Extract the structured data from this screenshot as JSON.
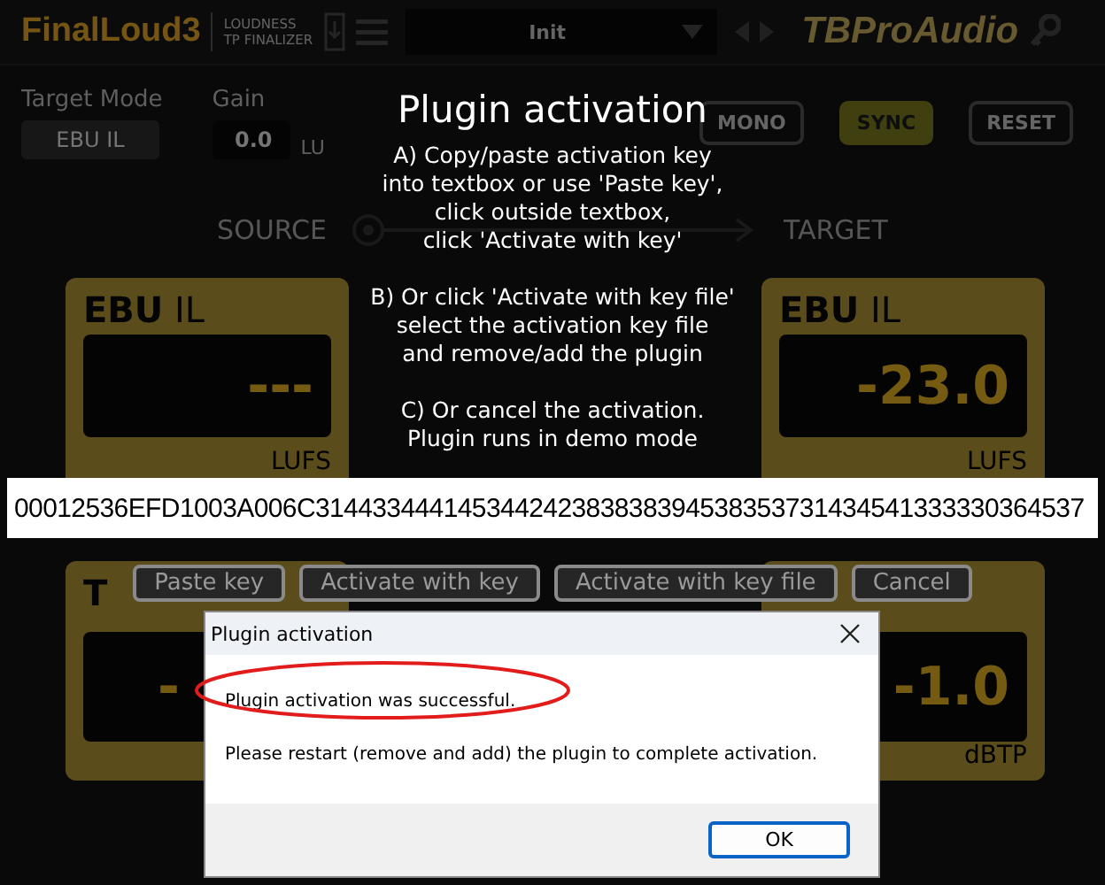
{
  "plugin": {
    "logo": "FinalLoud3",
    "subtitle_lines": [
      "LOUDNESS",
      "TP FINALIZER"
    ],
    "preset": "Init",
    "brand": "TBProAudio",
    "controls": [
      {
        "label": "Target Mode",
        "value": "EBU IL"
      },
      {
        "label": "Gain",
        "value": "0.0",
        "unit": "LU"
      }
    ],
    "toggles": [
      {
        "label": "MONO",
        "on": false
      },
      {
        "label": "SYNC",
        "on": true
      },
      {
        "label": "RESET",
        "on": false
      }
    ],
    "flow": {
      "source": "SOURCE",
      "target": "TARGET"
    },
    "meters": [
      {
        "title": "**EBU** IL",
        "value": "---",
        "unit": "LUFS"
      },
      {
        "title": "**EBU** IL",
        "value": "-23.0",
        "unit": "LUFS"
      },
      {
        "title": "**T**",
        "value": "-"
      },
      {
        "value": "-1.0",
        "unit": "dBTP"
      }
    ]
  },
  "activation": {
    "title": "Plugin activation",
    "paragraphs": [
      [
        "A) Copy/paste activation key",
        "into textbox or use 'Paste key',",
        "click outside textbox,",
        "click 'Activate with key'"
      ],
      [
        "B) Or click 'Activate with key file'",
        "select the activation key file",
        "and remove/add the plugin"
      ],
      [
        "C) Or cancel the activation.",
        "Plugin runs in demo mode"
      ]
    ],
    "key_field": {
      "value": "00012536EFD1003A006C314433444145344242383838394538353731434541333330364537"
    },
    "buttons": [
      "Paste key",
      "Activate with key",
      "Activate with key file",
      "Cancel"
    ]
  },
  "dialog": {
    "title": "Plugin activation",
    "messages": [
      {
        "text": "Plugin activation was successful.",
        "highlighted": true
      },
      {
        "text": "Please restart (remove and add) the plugin to complete activation.",
        "highlighted": false
      }
    ],
    "buttons": [
      {
        "label": "OK",
        "default": true
      }
    ]
  }
}
